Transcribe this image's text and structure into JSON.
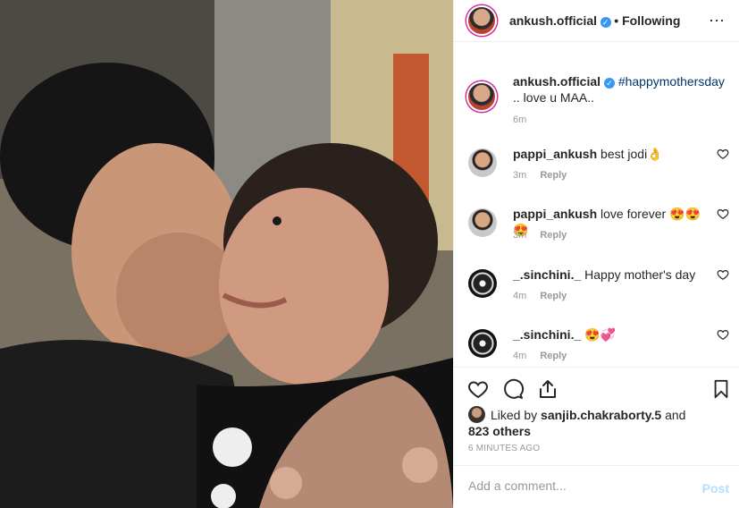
{
  "post": {
    "author": "ankush.official",
    "follow_status": "• Following",
    "more_icon": "⋯",
    "caption_user": "ankush.official",
    "caption_hashtag": "#happymothersday",
    "caption_text": ".. love u MAA..",
    "caption_time": "6m"
  },
  "comments": [
    {
      "user": "pappi_ankush",
      "text": "best jodi👌",
      "time": "3m",
      "reply": "Reply"
    },
    {
      "user": "pappi_ankush",
      "text": "love forever 😍😍😍",
      "time": "3m",
      "reply": "Reply"
    },
    {
      "user": "_.sinchini._",
      "text": "Happy mother's day",
      "time": "4m",
      "reply": "Reply"
    },
    {
      "user": "_.sinchini._",
      "text": "😍💞",
      "time": "4m",
      "reply": "Reply"
    }
  ],
  "likes": {
    "prefix": "Liked by",
    "user": "sanjib.chakraborty.5",
    "and": "and",
    "others": "823 others"
  },
  "timestamp": "6 MINUTES AGO",
  "composer": {
    "placeholder": "Add a comment...",
    "post_label": "Post"
  },
  "colors": {
    "link": "#003569",
    "verified": "#3897f0",
    "post_disabled": "#b2dffc"
  }
}
